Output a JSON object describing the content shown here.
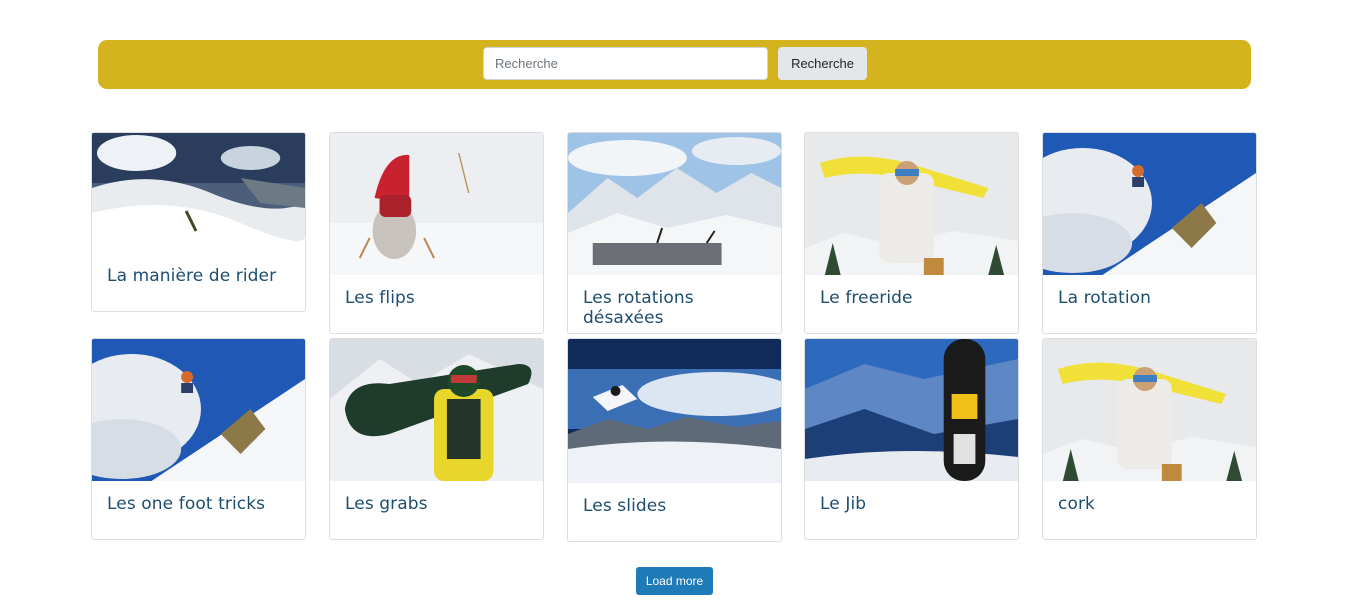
{
  "search": {
    "placeholder": "Recherche",
    "value": "",
    "button_label": "Recherche"
  },
  "cards": [
    {
      "title": "La manière de rider"
    },
    {
      "title": "Les flips"
    },
    {
      "title": "Les rotations désaxées"
    },
    {
      "title": "Le freeride"
    },
    {
      "title": "La rotation"
    },
    {
      "title": "Les one foot tricks"
    },
    {
      "title": "Les grabs"
    },
    {
      "title": "Les slides"
    },
    {
      "title": "Le Jib"
    },
    {
      "title": "cork"
    }
  ],
  "load_more_label": "Load more",
  "colors": {
    "search_bar": "#d3b41e",
    "card_title": "#1d4d6f",
    "load_more": "#1f7ab8"
  }
}
